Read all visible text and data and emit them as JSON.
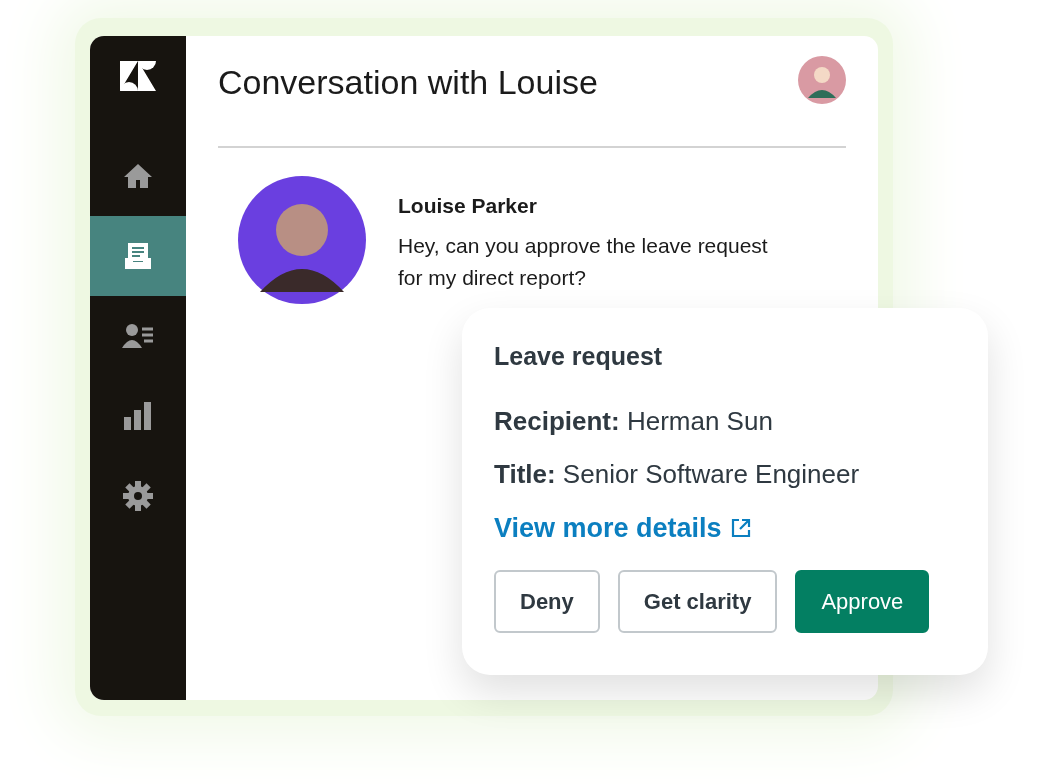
{
  "window": {
    "title": "Conversation with Louise"
  },
  "sidebar": {
    "items": [
      {
        "kind": "home",
        "selected": false
      },
      {
        "kind": "tickets",
        "selected": true
      },
      {
        "kind": "contacts",
        "selected": false
      },
      {
        "kind": "reports",
        "selected": false
      },
      {
        "kind": "settings",
        "selected": false
      }
    ]
  },
  "message": {
    "sender": "Louise Parker",
    "text": "Hey, can you approve the leave request for my direct report?"
  },
  "card": {
    "title": "Leave request",
    "fields": [
      {
        "label": "Recipient:",
        "value": "Herman Sun"
      },
      {
        "label": "Title:",
        "value": "Senior Software Engineer"
      }
    ],
    "link": "View more details",
    "buttons": [
      {
        "label": "Deny",
        "kind": "outline"
      },
      {
        "label": "Get clarity",
        "kind": "outline"
      },
      {
        "label": "Approve",
        "kind": "primary"
      }
    ]
  }
}
